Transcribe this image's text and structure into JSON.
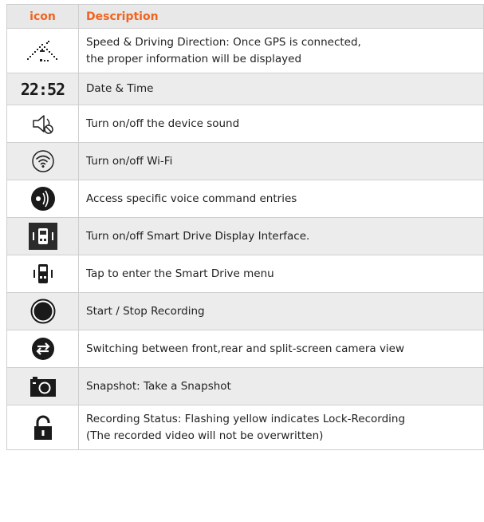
{
  "header": {
    "icon_col": "icon",
    "desc_col": "Description"
  },
  "rows": [
    {
      "icon": "speed-direction-icon",
      "lines": [
        "Speed & Driving Direction: Once GPS is connected,",
        "the proper information will be displayed"
      ]
    },
    {
      "icon": "date-time-icon",
      "icon_text": "22:52",
      "lines": [
        "Date & Time"
      ]
    },
    {
      "icon": "sound-off-icon",
      "lines": [
        "Turn on/off the device sound"
      ]
    },
    {
      "icon": "wifi-icon",
      "lines": [
        "Turn on/off Wi-Fi"
      ]
    },
    {
      "icon": "voice-command-icon",
      "lines": [
        "Access specific voice command entries"
      ]
    },
    {
      "icon": "smart-drive-display-icon",
      "lines": [
        "Turn on/off Smart Drive Display Interface."
      ]
    },
    {
      "icon": "smart-drive-menu-icon",
      "lines": [
        "Tap to enter the Smart Drive menu"
      ]
    },
    {
      "icon": "record-icon",
      "lines": [
        "Start / Stop Recording"
      ]
    },
    {
      "icon": "switch-camera-icon",
      "lines": [
        "Switching between front,rear and split-screen camera view"
      ]
    },
    {
      "icon": "camera-icon",
      "lines": [
        "Snapshot: Take a Snapshot"
      ]
    },
    {
      "icon": "lock-icon",
      "lines": [
        "Recording Status: Flashing yellow indicates Lock-Recording",
        "(The recorded video will not be overwritten)"
      ]
    }
  ]
}
